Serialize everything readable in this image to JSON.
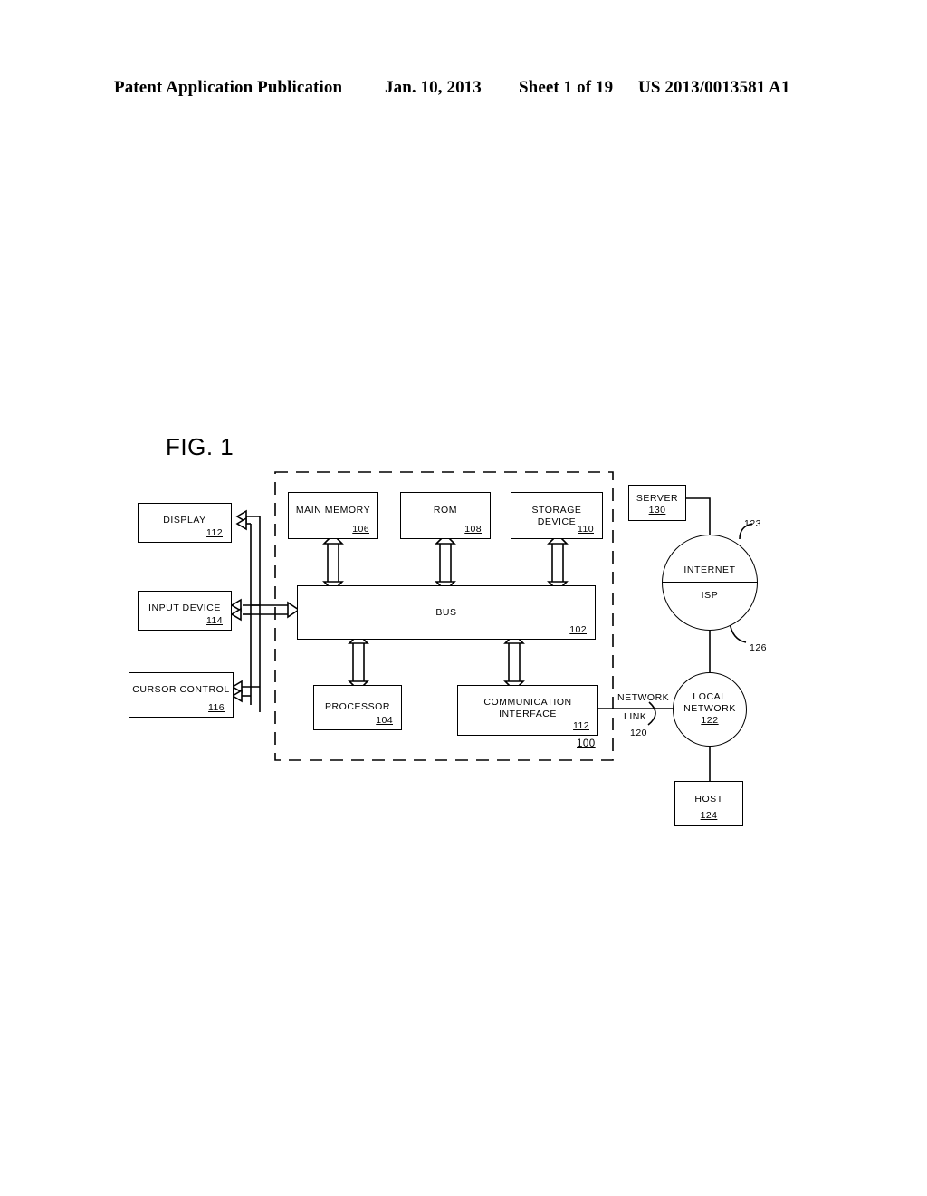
{
  "header": {
    "publication": "Patent Application Publication",
    "date": "Jan. 10, 2013",
    "sheet": "Sheet 1 of 19",
    "number": "US 2013/0013581 A1"
  },
  "figure": {
    "title": "FIG. 1",
    "system_ref": "100",
    "nodes": {
      "display": {
        "label": "DISPLAY",
        "ref": "112"
      },
      "input_device": {
        "label": "INPUT DEVICE",
        "ref": "114"
      },
      "cursor_control": {
        "label": "CURSOR CONTROL",
        "ref": "116"
      },
      "main_memory": {
        "label": "MAIN MEMORY",
        "ref": "106"
      },
      "rom": {
        "label": "ROM",
        "ref": "108"
      },
      "storage_device": {
        "label": "STORAGE DEVICE",
        "ref": "110"
      },
      "bus": {
        "label": "BUS",
        "ref": "102"
      },
      "processor": {
        "label": "PROCESSOR",
        "ref": "104"
      },
      "comm_interface": {
        "label_line1": "COMMUNICATION",
        "label_line2": "INTERFACE",
        "ref": "112"
      },
      "server": {
        "label": "SERVER",
        "ref": "130"
      },
      "host": {
        "label": "HOST",
        "ref": "124"
      },
      "internet": {
        "label_top": "INTERNET",
        "label_bottom": "ISP"
      },
      "local_network": {
        "label_line1": "LOCAL",
        "label_line2": "NETWORK",
        "ref": "122"
      }
    },
    "annotations": {
      "network_link_top": "NETWORK",
      "network_link_bottom": "LINK",
      "network_link_ref": "120",
      "internet_upper_ref": "123",
      "internet_lower_ref": "126"
    }
  }
}
